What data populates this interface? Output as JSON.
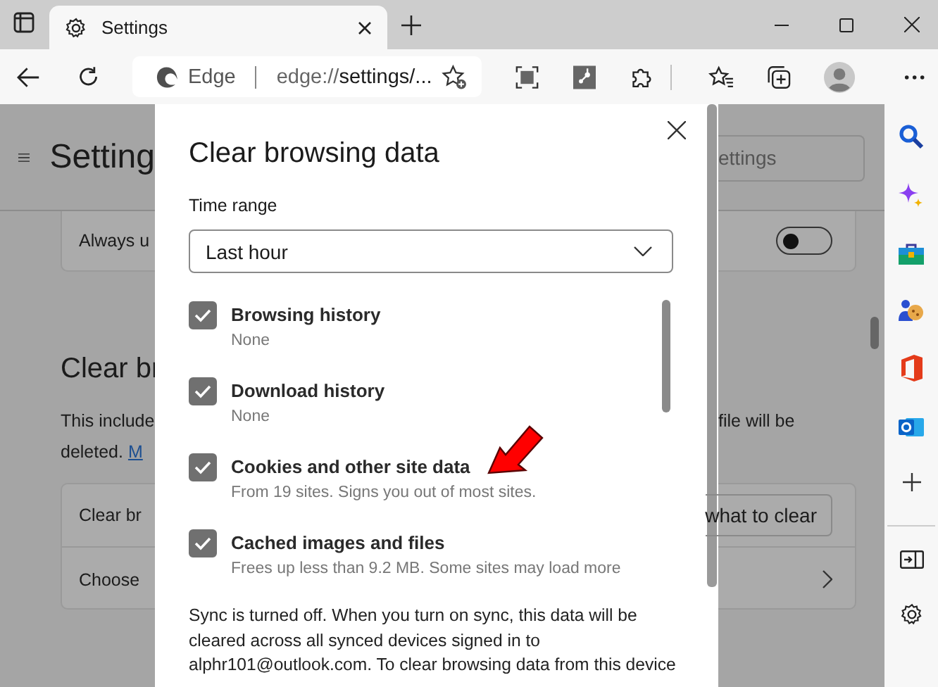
{
  "tab": {
    "title": "Settings",
    "selected": true
  },
  "address_bar": {
    "site": "Edge",
    "url_scheme": "edge://",
    "url_path": "settings/..."
  },
  "page": {
    "title": "Setting",
    "search": {
      "placeholder": "ettings"
    },
    "always_row": "Always u",
    "toggle": {
      "on": false
    },
    "section_heading": "Clear br",
    "description_left": [
      "This include",
      "deleted."
    ],
    "description_link": "M",
    "description_right": "file will be",
    "rows": [
      {
        "label": "Clear br",
        "button": "what to clear"
      },
      {
        "label": "Choose"
      }
    ]
  },
  "dialog": {
    "title": "Clear browsing data",
    "time_range_label": "Time range",
    "time_range": "Last hour",
    "items": [
      {
        "label": "Browsing history",
        "detail": "None",
        "checked": true
      },
      {
        "label": "Download history",
        "detail": "None",
        "checked": true
      },
      {
        "label": "Cookies and other site data",
        "detail": "From 19 sites. Signs you out of most sites.",
        "checked": true
      },
      {
        "label": "Cached images and files",
        "detail": "Frees up less than 9.2 MB. Some sites may load more",
        "checked": true
      }
    ],
    "sync_text_lines": [
      "Sync is turned off. When you turn on sync, this data will be",
      "cleared across all synced devices signed in to",
      "alphr101@outlook.com. To clear browsing data from this device"
    ]
  }
}
